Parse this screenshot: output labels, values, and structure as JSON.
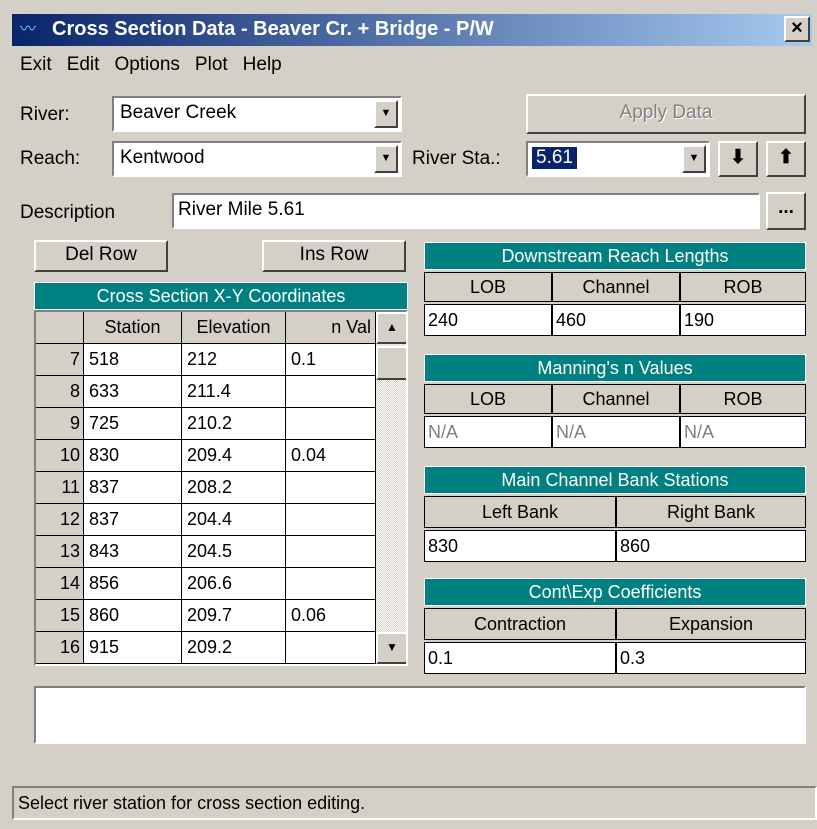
{
  "window": {
    "title": "Cross Section Data - Beaver Cr. + Bridge - P/W",
    "close_label": "×"
  },
  "menu": [
    "Exit",
    "Edit",
    "Options",
    "Plot",
    "Help"
  ],
  "river": {
    "label": "River:",
    "value": "Beaver Creek"
  },
  "reach": {
    "label": "Reach:",
    "value": "Kentwood"
  },
  "river_sta": {
    "label": "River Sta.:",
    "value": "5.61"
  },
  "apply_button": "Apply Data",
  "nav": {
    "down": "⬇",
    "up": "⬆"
  },
  "description": {
    "label": "Description",
    "value": "River Mile 5.61",
    "browse": "..."
  },
  "del_row": "Del Row",
  "ins_row": "Ins Row",
  "xy_table": {
    "title": "Cross Section X-Y Coordinates",
    "columns": [
      "Station",
      "Elevation",
      "n Val"
    ],
    "rows": [
      {
        "num": "7",
        "station": "518",
        "elevation": "212",
        "nval": "0.1"
      },
      {
        "num": "8",
        "station": "633",
        "elevation": "211.4",
        "nval": ""
      },
      {
        "num": "9",
        "station": "725",
        "elevation": "210.2",
        "nval": ""
      },
      {
        "num": "10",
        "station": "830",
        "elevation": "209.4",
        "nval": "0.04"
      },
      {
        "num": "11",
        "station": "837",
        "elevation": "208.2",
        "nval": ""
      },
      {
        "num": "12",
        "station": "837",
        "elevation": "204.4",
        "nval": ""
      },
      {
        "num": "13",
        "station": "843",
        "elevation": "204.5",
        "nval": ""
      },
      {
        "num": "14",
        "station": "856",
        "elevation": "206.6",
        "nval": ""
      },
      {
        "num": "15",
        "station": "860",
        "elevation": "209.7",
        "nval": "0.06"
      },
      {
        "num": "16",
        "station": "915",
        "elevation": "209.2",
        "nval": ""
      }
    ]
  },
  "reach_lengths": {
    "title": "Downstream Reach Lengths",
    "headers": [
      "LOB",
      "Channel",
      "ROB"
    ],
    "values": [
      "240",
      "460",
      "190"
    ]
  },
  "mannings": {
    "title": "Manning's n Values",
    "headers": [
      "LOB",
      "Channel",
      "ROB"
    ],
    "values": [
      "N/A",
      "N/A",
      "N/A"
    ]
  },
  "bank_stations": {
    "title": "Main Channel Bank Stations",
    "headers": [
      "Left Bank",
      "Right Bank"
    ],
    "values": [
      "830",
      "860"
    ]
  },
  "coefficients": {
    "title": "Cont\\Exp  Coefficients",
    "headers": [
      "Contraction",
      "Expansion"
    ],
    "values": [
      "0.1",
      "0.3"
    ]
  },
  "status": "Select river station for cross section editing.",
  "colors": {
    "header_teal": "#008080",
    "selection": "#0a246a",
    "titlebar": "#0a246a"
  }
}
